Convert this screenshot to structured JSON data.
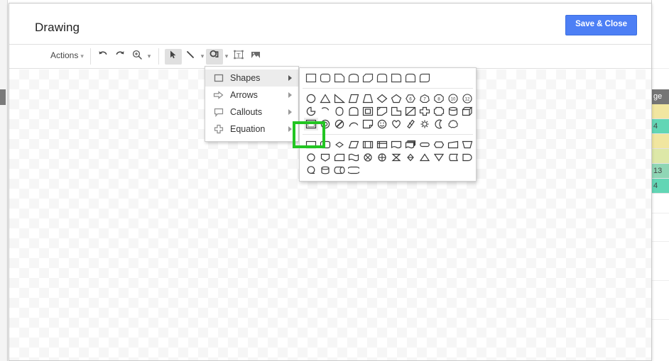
{
  "dialog": {
    "title": "Drawing",
    "save_close_label": "Save & Close"
  },
  "toolbar": {
    "actions_label": "Actions",
    "actions_caret": "▾",
    "buttons": [
      {
        "name": "undo",
        "icon": "undo-icon",
        "title": "Undo"
      },
      {
        "name": "redo",
        "icon": "redo-icon",
        "title": "Redo"
      },
      {
        "name": "zoom",
        "icon": "zoom-icon",
        "title": "Zoom"
      },
      {
        "name": "select",
        "icon": "select-arrow-icon",
        "title": "Select",
        "active": true
      },
      {
        "name": "line",
        "icon": "line-icon",
        "title": "Line"
      },
      {
        "name": "shape",
        "icon": "shape-icon",
        "title": "Shape",
        "active": true
      },
      {
        "name": "text-box",
        "icon": "text-box-icon",
        "title": "Text box"
      },
      {
        "name": "image",
        "icon": "image-icon",
        "title": "Image"
      }
    ],
    "caret_glyph": "▾"
  },
  "shape_menu": {
    "items": [
      {
        "label": "Shapes",
        "icon": "square-outline-icon",
        "selected": true,
        "has_submenu": true
      },
      {
        "label": "Arrows",
        "icon": "block-arrow-icon",
        "selected": false,
        "has_submenu": true
      },
      {
        "label": "Callouts",
        "icon": "speech-bubble-icon",
        "selected": false,
        "has_submenu": true
      },
      {
        "label": "Equation",
        "icon": "plus-cross-icon",
        "selected": false,
        "has_submenu": true
      }
    ]
  },
  "shape_palette": {
    "highlighted_shape": "frame-rectangle",
    "highlight_color": "#22c522",
    "sections": [
      {
        "name": "recent",
        "rows": [
          [
            "rectangle",
            "rounded-rectangle",
            "snip-single-corner-rectangle",
            "round-single-corner-top-rectangle",
            "snip-diagonal-corner-rectangle",
            "round-same-side-corner-rectangle",
            "snip-round-single-corner-rectangle",
            "round-diagonal-corner-rectangle",
            "round-corner-rectangle-2"
          ]
        ]
      },
      {
        "name": "basic-shapes",
        "rows": [
          [
            "ellipse",
            "triangle",
            "right-triangle",
            "parallelogram",
            "trapezoid",
            "diamond",
            "pentagon",
            "hexagon-6",
            "heptagon-7",
            "octagon-8",
            "decagon-10",
            "dodecagon-12"
          ],
          [
            "pie",
            "arc-chord",
            "teardrop",
            "half-frame",
            "frame-square",
            "corner",
            "l-shape",
            "diagonal-stripe",
            "cross",
            "plaque",
            "cylinder",
            "cube"
          ],
          [
            "frame-rectangle",
            "donut",
            "no-symbol",
            "arc",
            "folded-corner",
            "smiley-face",
            "heart",
            "lightning-bolt",
            "sun",
            "moon",
            "cloud"
          ]
        ]
      },
      {
        "name": "flowchart",
        "rows": [
          [
            "flow-process",
            "flow-alternate-process",
            "flow-decision",
            "flow-data",
            "flow-predefined-process",
            "flow-internal-storage",
            "flow-document",
            "flow-multidocument",
            "flow-terminator",
            "flow-preparation",
            "flow-manual-input",
            "flow-manual-operation"
          ],
          [
            "flow-connector",
            "flow-off-page-connector",
            "flow-card",
            "flow-punched-tape",
            "flow-summing-junction",
            "flow-or",
            "flow-collate",
            "flow-sort",
            "flow-extract",
            "flow-merge",
            "flow-stored-data",
            "flow-delay"
          ],
          [
            "flow-sequential-access",
            "flow-magnetic-disk",
            "flow-direct-access-storage",
            "flow-display"
          ]
        ]
      }
    ]
  },
  "background_sheet": {
    "header_label": "ge",
    "cells": [
      {
        "value": "",
        "color": "#f1e6a0"
      },
      {
        "value": "4",
        "color": "#62d6b5"
      },
      {
        "value": "",
        "color": "#f1e6a0"
      },
      {
        "value": "",
        "color": "#dde8a8"
      },
      {
        "value": "13",
        "color": "#8fd6b5"
      },
      {
        "value": "4",
        "color": "#62d6b5"
      }
    ]
  },
  "colors": {
    "accent_blue": "#4d7ff5",
    "highlight_green": "#22c522",
    "toolbar_active": "#e0e0e0",
    "menu_selected": "#ececec"
  }
}
